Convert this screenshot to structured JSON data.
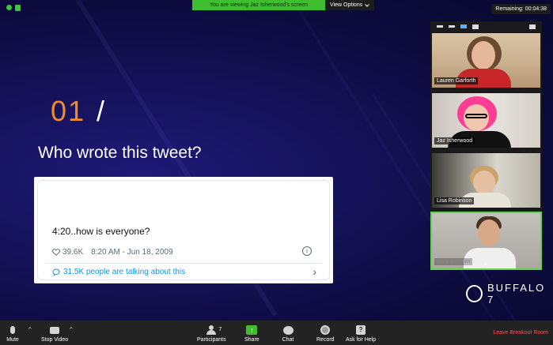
{
  "banner": {
    "viewing_message": "You are viewing Jaz Isherwood's screen",
    "view_options_label": "View Options"
  },
  "timer": {
    "remaining_label": "Remaining: 00:04:38"
  },
  "slide": {
    "question_number": "01",
    "separator": "/",
    "question": "Who wrote this tweet?",
    "tweet": {
      "text": "4:20..how is everyone?",
      "likes": "39.6K",
      "timestamp": "8:20 AM - Jun 18, 2009",
      "info_glyph": "i",
      "talking_label": "31.5K people are talking about this",
      "chevron": "›"
    },
    "brand_name": "BUFFALO 7"
  },
  "gallery": {
    "participants": [
      {
        "name": "Lauren Garforth"
      },
      {
        "name": "Jaz Isherwood"
      },
      {
        "name": "Lisa Robinson"
      },
      {
        "name": "Rory Saltman"
      }
    ],
    "scroll_chevron": "⌄"
  },
  "toolbar": {
    "mute_label": "Mute",
    "stop_video_label": "Stop Video",
    "participants_label": "Participants",
    "participants_count": "7",
    "share_label": "Share",
    "chat_label": "Chat",
    "record_label": "Record",
    "ask_help_label": "Ask for Help",
    "ask_help_glyph": "?",
    "leave_label": "Leave Breakout Room",
    "caret_glyph": "^"
  },
  "colors": {
    "accent_orange": "#f28a2b",
    "banner_green": "#3fbf30",
    "leave_red": "#ff4f4f",
    "link_blue": "#1b95e0",
    "active_speaker": "#5fd84a"
  }
}
